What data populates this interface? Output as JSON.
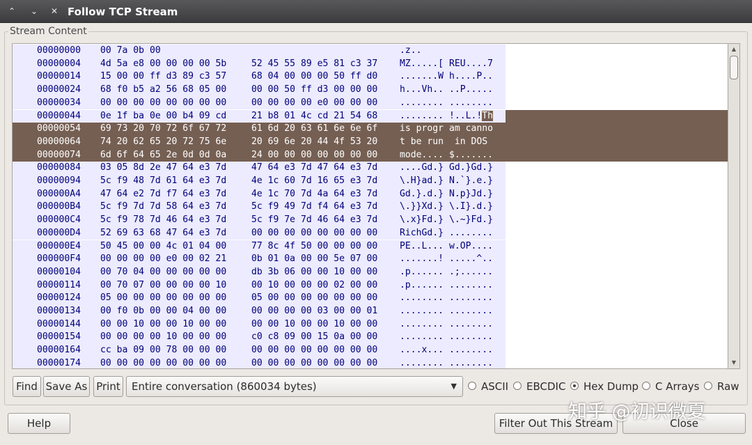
{
  "window": {
    "title": "Follow TCP Stream",
    "controls": [
      "^",
      "v",
      "x"
    ]
  },
  "group": {
    "label": "Stream Content"
  },
  "rows": [
    {
      "offset": "00000000",
      "hex1": "00 7a 0b 00",
      "hex2": "",
      "ascii": ".z..",
      "selected": false
    },
    {
      "offset": "00000004",
      "hex1": "4d 5a e8 00 00 00 00 5b",
      "hex2": "52 45 55 89 e5 81 c3 37",
      "ascii": "MZ.....[ REU....7",
      "selected": false
    },
    {
      "offset": "00000014",
      "hex1": "15 00 00 ff d3 89 c3 57",
      "hex2": "68 04 00 00 00 50 ff d0",
      "ascii": ".......W h....P..",
      "selected": false
    },
    {
      "offset": "00000024",
      "hex1": "68 f0 b5 a2 56 68 05 00",
      "hex2": "00 00 50 ff d3 00 00 00",
      "ascii": "h...Vh.. ..P.....",
      "selected": false
    },
    {
      "offset": "00000034",
      "hex1": "00 00 00 00 00 00 00 00",
      "hex2": "00 00 00 00 e0 00 00 00",
      "ascii": "........ ........",
      "selected": false
    },
    {
      "offset": "00000044",
      "hex1": "0e 1f ba 0e 00 b4 09 cd",
      "hex2": "21 b8 01 4c cd 21 54 68",
      "ascii": "........ !..L.!Th",
      "selected": false,
      "partial": true
    },
    {
      "offset": "00000054",
      "hex1": "69 73 20 70 72 6f 67 72",
      "hex2": "61 6d 20 63 61 6e 6e 6f",
      "ascii": "is progr am canno",
      "selected": true
    },
    {
      "offset": "00000064",
      "hex1": "74 20 62 65 20 72 75 6e",
      "hex2": "20 69 6e 20 44 4f 53 20",
      "ascii": "t be run  in DOS ",
      "selected": true
    },
    {
      "offset": "00000074",
      "hex1": "6d 6f 64 65 2e 0d 0d 0a",
      "hex2": "24 00 00 00 00 00 00 00",
      "ascii": "mode.... $.......",
      "selected": true
    },
    {
      "offset": "00000084",
      "hex1": "03 05 8d 2e 47 64 e3 7d",
      "hex2": "47 64 e3 7d 47 64 e3 7d",
      "ascii": "....Gd.} Gd.}Gd.}",
      "selected": false
    },
    {
      "offset": "00000094",
      "hex1": "5c f9 48 7d 61 64 e3 7d",
      "hex2": "4e 1c 60 7d 16 65 e3 7d",
      "ascii": "\\.H}ad.} N.`}.e.}",
      "selected": false
    },
    {
      "offset": "000000A4",
      "hex1": "47 64 e2 7d f7 64 e3 7d",
      "hex2": "4e 1c 70 7d 4a 64 e3 7d",
      "ascii": "Gd.}.d.} N.p}Jd.}",
      "selected": false
    },
    {
      "offset": "000000B4",
      "hex1": "5c f9 7d 7d 58 64 e3 7d",
      "hex2": "5c f9 49 7d f4 64 e3 7d",
      "ascii": "\\.}}Xd.} \\.I}.d.}",
      "selected": false
    },
    {
      "offset": "000000C4",
      "hex1": "5c f9 78 7d 46 64 e3 7d",
      "hex2": "5c f9 7e 7d 46 64 e3 7d",
      "ascii": "\\.x}Fd.} \\.~}Fd.}",
      "selected": false
    },
    {
      "offset": "000000D4",
      "hex1": "52 69 63 68 47 64 e3 7d",
      "hex2": "00 00 00 00 00 00 00 00",
      "ascii": "RichGd.} ........",
      "selected": false
    },
    {
      "offset": "000000E4",
      "hex1": "50 45 00 00 4c 01 04 00",
      "hex2": "77 8c 4f 50 00 00 00 00",
      "ascii": "PE..L... w.OP....",
      "selected": false
    },
    {
      "offset": "000000F4",
      "hex1": "00 00 00 00 e0 00 02 21",
      "hex2": "0b 01 0a 00 00 5e 07 00",
      "ascii": ".......! .....^..",
      "selected": false
    },
    {
      "offset": "00000104",
      "hex1": "00 70 04 00 00 00 00 00",
      "hex2": "db 3b 06 00 00 10 00 00",
      "ascii": ".p...... .;......",
      "selected": false
    },
    {
      "offset": "00000114",
      "hex1": "00 70 07 00 00 00 00 10",
      "hex2": "00 10 00 00 00 02 00 00",
      "ascii": ".p...... ........",
      "selected": false
    },
    {
      "offset": "00000124",
      "hex1": "05 00 00 00 00 00 00 00",
      "hex2": "05 00 00 00 00 00 00 00",
      "ascii": "........ ........",
      "selected": false
    },
    {
      "offset": "00000134",
      "hex1": "00 f0 0b 00 00 04 00 00",
      "hex2": "00 00 00 00 03 00 00 01",
      "ascii": "........ ........",
      "selected": false
    },
    {
      "offset": "00000144",
      "hex1": "00 00 10 00 00 10 00 00",
      "hex2": "00 00 10 00 00 10 00 00",
      "ascii": "........ ........",
      "selected": false
    },
    {
      "offset": "00000154",
      "hex1": "00 00 00 00 10 00 00 00",
      "hex2": "c0 c8 09 00 15 0a 00 00",
      "ascii": "........ ........",
      "selected": false
    },
    {
      "offset": "00000164",
      "hex1": "cc ba 09 00 78 00 00 00",
      "hex2": "00 00 00 00 00 00 00 00",
      "ascii": "....x... ........",
      "selected": false
    },
    {
      "offset": "00000174",
      "hex1": "00 00 00 00 00 00 00 00",
      "hex2": "00 00 00 00 00 00 00 00",
      "ascii": "........ ........",
      "selected": false
    }
  ],
  "toolbar": {
    "find_label": "Find",
    "save_as_label": "Save As",
    "print_label": "Print",
    "conversation_selected": "Entire conversation (860034 bytes)"
  },
  "encodings": {
    "options": [
      "ASCII",
      "EBCDIC",
      "Hex Dump",
      "C Arrays",
      "Raw"
    ],
    "selected": "Hex Dump"
  },
  "footer": {
    "help_label": "Help",
    "filter_out_label": "Filter Out This Stream",
    "close_label": "Close"
  },
  "watermark": "知乎 @初识微夏",
  "colors": {
    "row_bg": "#ecebff",
    "text": "#00007a",
    "selection_bg": "#755f53",
    "selection_text": "#ffffff"
  }
}
